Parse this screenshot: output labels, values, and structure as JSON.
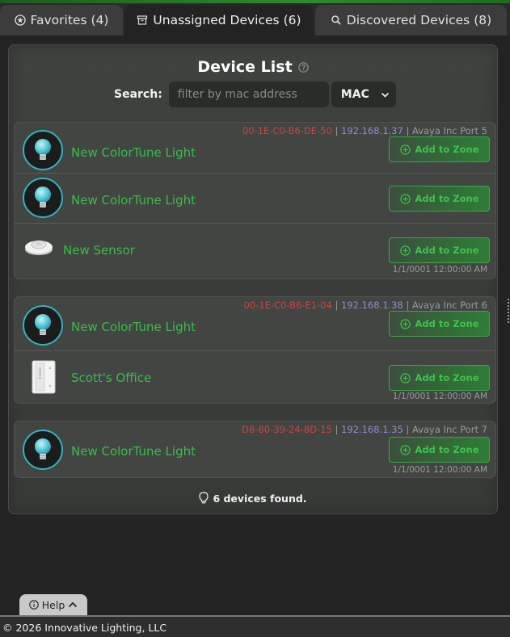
{
  "tabs": [
    {
      "label": "Favorites",
      "count": "(4)",
      "icon": "star-circle-icon"
    },
    {
      "label": "Unassigned Devices",
      "count": "(6)",
      "icon": "archive-box-icon"
    },
    {
      "label": "Discovered Devices",
      "count": "(8)",
      "icon": "magnifier-icon"
    }
  ],
  "panel": {
    "title": "Device List",
    "search_label": "Search:",
    "search_placeholder": "filter by mac address",
    "search_value": "",
    "filter_select": "MAC",
    "add_label": "Add to Zone",
    "found_text": "6 devices found."
  },
  "groups": [
    {
      "mac": "00-1E-C0-B6-DE-50",
      "ip": "192.168.1.37",
      "port": "Avaya Inc Port 5",
      "date": "1/1/0001 12:00:00 AM",
      "devices": [
        {
          "name": "New ColorTune Light",
          "icon": "bulb-icon"
        },
        {
          "name": "New ColorTune Light",
          "icon": "bulb-icon"
        },
        {
          "name": "New Sensor",
          "icon": "sensor-icon"
        }
      ]
    },
    {
      "mac": "00-1E-C0-B6-E1-04",
      "ip": "192.168.1.38",
      "port": "Avaya Inc Port 6",
      "date": "1/1/0001 12:00:00 AM",
      "devices": [
        {
          "name": "New ColorTune Light",
          "icon": "bulb-icon"
        },
        {
          "name": "Scott's Office",
          "icon": "wall-switch-icon"
        }
      ]
    },
    {
      "mac": "D8-80-39-24-8D-15",
      "ip": "192.168.1.35",
      "port": "Avaya Inc Port 7",
      "date": "1/1/0001 12:00:00 AM",
      "devices": [
        {
          "name": "New ColorTune Light",
          "icon": "bulb-icon"
        }
      ]
    }
  ],
  "help": {
    "label": "Help"
  },
  "footer": {
    "copyright": "© 2026 Innovative Lighting, LLC"
  },
  "colors": {
    "accent_green": "#3bbd4a",
    "mac_red": "#c94646",
    "ip_purple": "#8f8ecf",
    "bulb_ring": "#2fb4c4"
  }
}
